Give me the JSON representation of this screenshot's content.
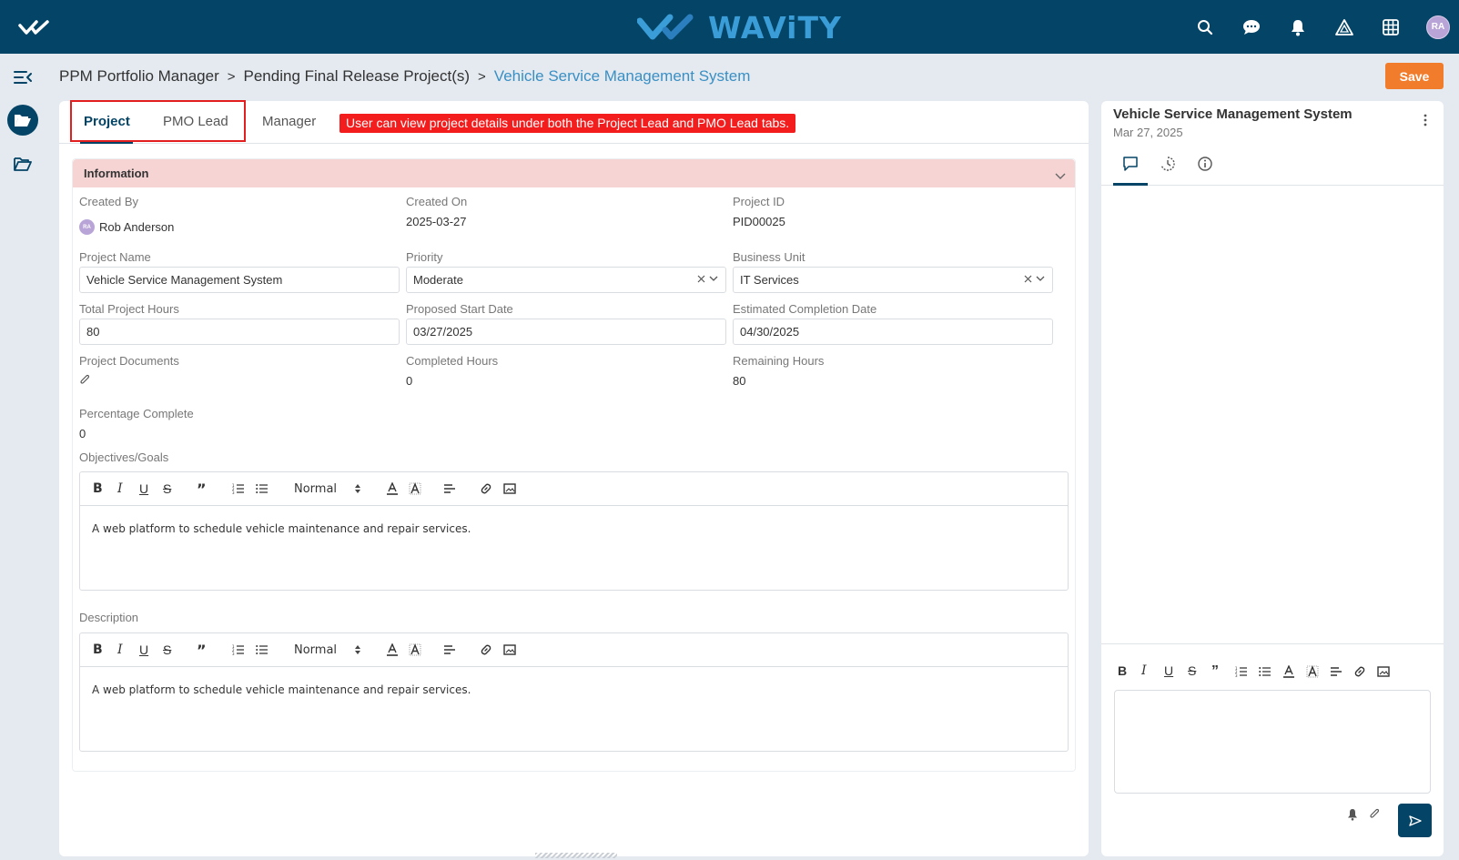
{
  "header": {
    "logo_text": "WAViTY",
    "avatar_initials": "RA",
    "icons": [
      "home-checks-icon",
      "search-icon",
      "chat-icon",
      "bell-icon",
      "alert-triangle-icon",
      "grid-icon"
    ]
  },
  "breadcrumb": {
    "items": [
      "PPM Portfolio Manager",
      "Pending Final Release Project(s)",
      "Vehicle Service Management System"
    ],
    "separator": ">"
  },
  "toolbar": {
    "save_label": "Save"
  },
  "tabs": [
    {
      "label": "Project",
      "active": true
    },
    {
      "label": "PMO Lead",
      "active": false
    },
    {
      "label": "Manager",
      "active": false
    }
  ],
  "annotation": "User can view project details under both the Project Lead and PMO Lead tabs.",
  "info": {
    "title": "Information",
    "created_by_label": "Created By",
    "created_by_initials": "RA",
    "created_by_value": "Rob Anderson",
    "created_on_label": "Created On",
    "created_on_value": "2025-03-27",
    "project_id_label": "Project ID",
    "project_id_value": "PID00025",
    "project_name_label": "Project Name",
    "project_name_value": "Vehicle Service Management System",
    "priority_label": "Priority",
    "priority_value": "Moderate",
    "business_unit_label": "Business Unit",
    "business_unit_value": "IT Services",
    "total_hours_label": "Total Project Hours",
    "total_hours_value": "80",
    "start_date_label": "Proposed Start Date",
    "start_date_value": "03/27/2025",
    "completion_date_label": "Estimated Completion Date",
    "completion_date_value": "04/30/2025",
    "documents_label": "Project Documents",
    "completed_hours_label": "Completed Hours",
    "completed_hours_value": "0",
    "remaining_hours_label": "Remaining Hours",
    "remaining_hours_value": "80",
    "percent_label": "Percentage Complete",
    "percent_value": "0",
    "objectives_label": "Objectives/Goals",
    "objectives_text": "A web platform to schedule vehicle maintenance and repair services.",
    "description_label": "Description",
    "description_text": "A web platform to schedule vehicle maintenance and repair services.",
    "format_select": "Normal"
  },
  "side": {
    "title": "Vehicle Service Management System",
    "date": "Mar 27, 2025"
  },
  "colors": {
    "header_bg": "#044466",
    "accent_blue": "#3a9dd8",
    "save_orange": "#f07c2c",
    "section_header": "#f7d4d4",
    "annotation_red": "#f31d1d"
  }
}
